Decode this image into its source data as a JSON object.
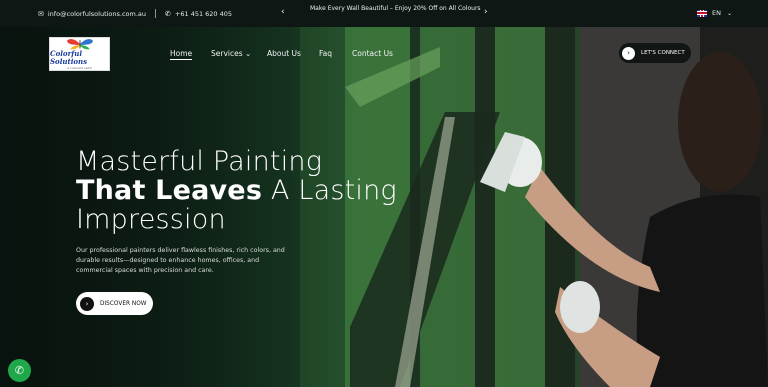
{
  "topbar": {
    "email": "info@colorfulsolutions.com.au",
    "phone": "+61 451 620 405",
    "promo": "Make Every Wall Beautiful – Enjoy 20% Off on All Colours",
    "prev_arrow": "‹",
    "next_arrow": "›",
    "language": "EN",
    "email_icon": "envelope-icon",
    "phone_icon": "phone-icon",
    "lang_dropdown_icon": "chevron-down-icon"
  },
  "logo": {
    "title": "Colorful Solutions",
    "tagline": "a colourful spirit"
  },
  "nav": {
    "items": [
      {
        "label": "Home",
        "active": true
      },
      {
        "label": "Services ⌄",
        "active": false
      },
      {
        "label": "About Us",
        "active": false
      },
      {
        "label": "Faq",
        "active": false
      },
      {
        "label": "Contact Us",
        "active": false
      }
    ],
    "cta": "LET'S CONNECT"
  },
  "hero": {
    "line1": "Masterful Painting",
    "line2_bold": "That Leaves",
    "line2_rest": " A Lasting",
    "line3": "Impression",
    "paragraph": "Our professional painters deliver flawless finishes, rich colors, and durable results—designed to enhance homes, offices, and commercial spaces with precision and care.",
    "button": "DISCOVER NOW"
  },
  "floating": {
    "phone_icon": "phone-icon",
    "phone_color": "#1ea84a"
  },
  "colors": {
    "topbar_bg": "#0e1713",
    "hero_green": "#2e5c33",
    "text_light": "#ffffff"
  }
}
